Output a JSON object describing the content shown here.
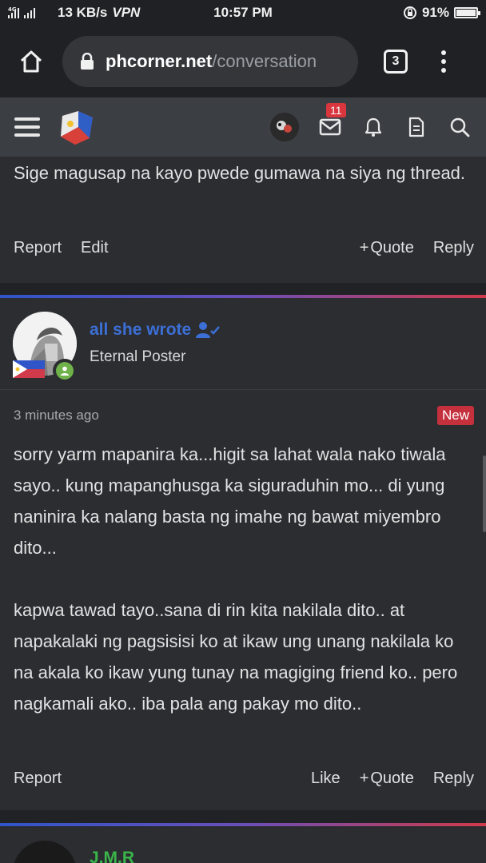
{
  "status_bar": {
    "network": "4G",
    "speed": "13 KB/s",
    "vpn": "VPN",
    "time": "10:57 PM",
    "battery": "91%",
    "battery_level": 0.91
  },
  "browser": {
    "url_host": "phcorner.net",
    "url_path": "/conversation",
    "tab_count": "3",
    "icons": [
      "home-icon",
      "lock-icon",
      "tabs-icon",
      "menu-icon"
    ]
  },
  "site_header": {
    "notification_count": "11",
    "icons": [
      "hamburger-icon",
      "site-logo",
      "avatar",
      "inbox-icon",
      "bell-icon",
      "document-icon",
      "search-icon"
    ]
  },
  "previous_post": {
    "text": "Sige magusap na kayo pwede gumawa na siya ng thread.",
    "actions": {
      "report": "Report",
      "edit": "Edit",
      "quote": "Quote",
      "reply": "Reply"
    }
  },
  "message": {
    "author": "all she wrote",
    "author_title": "Eternal Poster",
    "time": "3 minutes ago",
    "badge": "New",
    "paragraphs": [
      "sorry yarm mapanira ka...higit sa lahat wala nako tiwala sayo.. kung mapanghusga ka siguraduhin mo... di yung naninira ka nalang basta ng imahe ng bawat miyembro dito...",
      "kapwa tawad tayo..sana di rin kita nakilala dito.. at napakalaki ng pagsisisi ko at ikaw ung unang nakilala ko na akala ko ikaw yung tunay na magiging friend ko.. pero nagkamali ako.. iba pala ang pakay mo dito.."
    ],
    "actions": {
      "report": "Report",
      "like": "Like",
      "quote": "Quote",
      "reply": "Reply"
    }
  },
  "next_post": {
    "author": "J.M.R"
  },
  "colors": {
    "accent_blue": "#3c6fd6",
    "badge_red": "#c5303d",
    "online_green": "#6fb24a",
    "next_user_green": "#39b54a"
  }
}
